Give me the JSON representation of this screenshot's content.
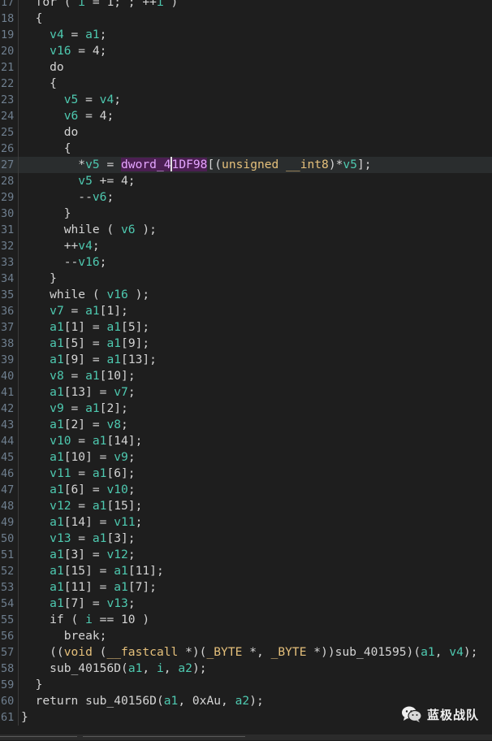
{
  "colors": {
    "background": "#1e1e1e",
    "identifier": "#4ec9b0",
    "type": "#e5c07b",
    "highlight_global": "#4b1f52",
    "line_number": "#6f7f8f"
  },
  "editor": {
    "highlighted_line": 27,
    "lines": [
      {
        "n": "17",
        "tokens": [
          [
            "t-kw",
            "  for ( "
          ],
          [
            "t-id",
            "i"
          ],
          [
            "t-op",
            " = 1; ; ++"
          ],
          [
            "t-id",
            "i"
          ],
          [
            "t-op",
            " )"
          ]
        ]
      },
      {
        "n": "18",
        "tokens": [
          [
            "t-op",
            "  {"
          ]
        ]
      },
      {
        "n": "19",
        "tokens": [
          [
            "t-op",
            "    "
          ],
          [
            "t-id",
            "v4"
          ],
          [
            "t-op",
            " = "
          ],
          [
            "t-id",
            "a1"
          ],
          [
            "t-op",
            ";"
          ]
        ]
      },
      {
        "n": "20",
        "tokens": [
          [
            "t-op",
            "    "
          ],
          [
            "t-id",
            "v16"
          ],
          [
            "t-op",
            " = 4;"
          ]
        ]
      },
      {
        "n": "21",
        "tokens": [
          [
            "t-kw",
            "    do"
          ]
        ]
      },
      {
        "n": "22",
        "tokens": [
          [
            "t-op",
            "    {"
          ]
        ]
      },
      {
        "n": "23",
        "tokens": [
          [
            "t-op",
            "      "
          ],
          [
            "t-id",
            "v5"
          ],
          [
            "t-op",
            " = "
          ],
          [
            "t-id",
            "v4"
          ],
          [
            "t-op",
            ";"
          ]
        ]
      },
      {
        "n": "24",
        "tokens": [
          [
            "t-op",
            "      "
          ],
          [
            "t-id",
            "v6"
          ],
          [
            "t-op",
            " = 4;"
          ]
        ]
      },
      {
        "n": "25",
        "tokens": [
          [
            "t-kw",
            "      do"
          ]
        ]
      },
      {
        "n": "26",
        "tokens": [
          [
            "t-op",
            "      {"
          ]
        ]
      },
      {
        "n": "27",
        "tokens": [
          [
            "t-op",
            "        *"
          ],
          [
            "t-id",
            "v5"
          ],
          [
            "t-op",
            " = "
          ],
          [
            "t-dw",
            "dword_4"
          ],
          [
            "cursor",
            ""
          ],
          [
            "t-dw",
            "1DF98"
          ],
          [
            "t-op",
            "[("
          ],
          [
            "t-ty",
            "unsigned __int8"
          ],
          [
            "t-op",
            ")*"
          ],
          [
            "t-id",
            "v5"
          ],
          [
            "t-op",
            "];"
          ]
        ]
      },
      {
        "n": "28",
        "tokens": [
          [
            "t-op",
            "        "
          ],
          [
            "t-id",
            "v5"
          ],
          [
            "t-op",
            " += 4;"
          ]
        ]
      },
      {
        "n": "29",
        "tokens": [
          [
            "t-op",
            "        --"
          ],
          [
            "t-id",
            "v6"
          ],
          [
            "t-op",
            ";"
          ]
        ]
      },
      {
        "n": "30",
        "tokens": [
          [
            "t-op",
            "      }"
          ]
        ]
      },
      {
        "n": "31",
        "tokens": [
          [
            "t-kw",
            "      while ( "
          ],
          [
            "t-id",
            "v6"
          ],
          [
            "t-op",
            " );"
          ]
        ]
      },
      {
        "n": "32",
        "tokens": [
          [
            "t-op",
            "      ++"
          ],
          [
            "t-id",
            "v4"
          ],
          [
            "t-op",
            ";"
          ]
        ]
      },
      {
        "n": "33",
        "tokens": [
          [
            "t-op",
            "      --"
          ],
          [
            "t-id",
            "v16"
          ],
          [
            "t-op",
            ";"
          ]
        ]
      },
      {
        "n": "34",
        "tokens": [
          [
            "t-op",
            "    }"
          ]
        ]
      },
      {
        "n": "35",
        "tokens": [
          [
            "t-kw",
            "    while ( "
          ],
          [
            "t-id",
            "v16"
          ],
          [
            "t-op",
            " );"
          ]
        ]
      },
      {
        "n": "36",
        "tokens": [
          [
            "t-op",
            "    "
          ],
          [
            "t-id",
            "v7"
          ],
          [
            "t-op",
            " = "
          ],
          [
            "t-id",
            "a1"
          ],
          [
            "t-op",
            "[1];"
          ]
        ]
      },
      {
        "n": "37",
        "tokens": [
          [
            "t-op",
            "    "
          ],
          [
            "t-id",
            "a1"
          ],
          [
            "t-op",
            "[1] = "
          ],
          [
            "t-id",
            "a1"
          ],
          [
            "t-op",
            "[5];"
          ]
        ]
      },
      {
        "n": "38",
        "tokens": [
          [
            "t-op",
            "    "
          ],
          [
            "t-id",
            "a1"
          ],
          [
            "t-op",
            "[5] = "
          ],
          [
            "t-id",
            "a1"
          ],
          [
            "t-op",
            "[9];"
          ]
        ]
      },
      {
        "n": "39",
        "tokens": [
          [
            "t-op",
            "    "
          ],
          [
            "t-id",
            "a1"
          ],
          [
            "t-op",
            "[9] = "
          ],
          [
            "t-id",
            "a1"
          ],
          [
            "t-op",
            "[13];"
          ]
        ]
      },
      {
        "n": "40",
        "tokens": [
          [
            "t-op",
            "    "
          ],
          [
            "t-id",
            "v8"
          ],
          [
            "t-op",
            " = "
          ],
          [
            "t-id",
            "a1"
          ],
          [
            "t-op",
            "[10];"
          ]
        ]
      },
      {
        "n": "41",
        "tokens": [
          [
            "t-op",
            "    "
          ],
          [
            "t-id",
            "a1"
          ],
          [
            "t-op",
            "[13] = "
          ],
          [
            "t-id",
            "v7"
          ],
          [
            "t-op",
            ";"
          ]
        ]
      },
      {
        "n": "42",
        "tokens": [
          [
            "t-op",
            "    "
          ],
          [
            "t-id",
            "v9"
          ],
          [
            "t-op",
            " = "
          ],
          [
            "t-id",
            "a1"
          ],
          [
            "t-op",
            "[2];"
          ]
        ]
      },
      {
        "n": "43",
        "tokens": [
          [
            "t-op",
            "    "
          ],
          [
            "t-id",
            "a1"
          ],
          [
            "t-op",
            "[2] = "
          ],
          [
            "t-id",
            "v8"
          ],
          [
            "t-op",
            ";"
          ]
        ]
      },
      {
        "n": "44",
        "tokens": [
          [
            "t-op",
            "    "
          ],
          [
            "t-id",
            "v10"
          ],
          [
            "t-op",
            " = "
          ],
          [
            "t-id",
            "a1"
          ],
          [
            "t-op",
            "[14];"
          ]
        ]
      },
      {
        "n": "45",
        "tokens": [
          [
            "t-op",
            "    "
          ],
          [
            "t-id",
            "a1"
          ],
          [
            "t-op",
            "[10] = "
          ],
          [
            "t-id",
            "v9"
          ],
          [
            "t-op",
            ";"
          ]
        ]
      },
      {
        "n": "46",
        "tokens": [
          [
            "t-op",
            "    "
          ],
          [
            "t-id",
            "v11"
          ],
          [
            "t-op",
            " = "
          ],
          [
            "t-id",
            "a1"
          ],
          [
            "t-op",
            "[6];"
          ]
        ]
      },
      {
        "n": "47",
        "tokens": [
          [
            "t-op",
            "    "
          ],
          [
            "t-id",
            "a1"
          ],
          [
            "t-op",
            "[6] = "
          ],
          [
            "t-id",
            "v10"
          ],
          [
            "t-op",
            ";"
          ]
        ]
      },
      {
        "n": "48",
        "tokens": [
          [
            "t-op",
            "    "
          ],
          [
            "t-id",
            "v12"
          ],
          [
            "t-op",
            " = "
          ],
          [
            "t-id",
            "a1"
          ],
          [
            "t-op",
            "[15];"
          ]
        ]
      },
      {
        "n": "49",
        "tokens": [
          [
            "t-op",
            "    "
          ],
          [
            "t-id",
            "a1"
          ],
          [
            "t-op",
            "[14] = "
          ],
          [
            "t-id",
            "v11"
          ],
          [
            "t-op",
            ";"
          ]
        ]
      },
      {
        "n": "50",
        "tokens": [
          [
            "t-op",
            "    "
          ],
          [
            "t-id",
            "v13"
          ],
          [
            "t-op",
            " = "
          ],
          [
            "t-id",
            "a1"
          ],
          [
            "t-op",
            "[3];"
          ]
        ]
      },
      {
        "n": "51",
        "tokens": [
          [
            "t-op",
            "    "
          ],
          [
            "t-id",
            "a1"
          ],
          [
            "t-op",
            "[3] = "
          ],
          [
            "t-id",
            "v12"
          ],
          [
            "t-op",
            ";"
          ]
        ]
      },
      {
        "n": "52",
        "tokens": [
          [
            "t-op",
            "    "
          ],
          [
            "t-id",
            "a1"
          ],
          [
            "t-op",
            "[15] = "
          ],
          [
            "t-id",
            "a1"
          ],
          [
            "t-op",
            "[11];"
          ]
        ]
      },
      {
        "n": "53",
        "tokens": [
          [
            "t-op",
            "    "
          ],
          [
            "t-id",
            "a1"
          ],
          [
            "t-op",
            "[11] = "
          ],
          [
            "t-id",
            "a1"
          ],
          [
            "t-op",
            "[7];"
          ]
        ]
      },
      {
        "n": "54",
        "tokens": [
          [
            "t-op",
            "    "
          ],
          [
            "t-id",
            "a1"
          ],
          [
            "t-op",
            "[7] = "
          ],
          [
            "t-id",
            "v13"
          ],
          [
            "t-op",
            ";"
          ]
        ]
      },
      {
        "n": "55",
        "tokens": [
          [
            "t-kw",
            "    if ( "
          ],
          [
            "t-id",
            "i"
          ],
          [
            "t-op",
            " == 10 )"
          ]
        ]
      },
      {
        "n": "56",
        "tokens": [
          [
            "t-kw",
            "      break;"
          ]
        ]
      },
      {
        "n": "57",
        "tokens": [
          [
            "t-op",
            "    (("
          ],
          [
            "t-ty",
            "void"
          ],
          [
            "t-op",
            " ("
          ],
          [
            "t-ty",
            "__fastcall"
          ],
          [
            "t-op",
            " *)("
          ],
          [
            "t-ty",
            "_BYTE"
          ],
          [
            "t-op",
            " *, "
          ],
          [
            "t-ty",
            "_BYTE"
          ],
          [
            "t-op",
            " *))"
          ],
          [
            "t-fn",
            "sub_401595"
          ],
          [
            "t-op",
            ")("
          ],
          [
            "t-id",
            "a1"
          ],
          [
            "t-op",
            ", "
          ],
          [
            "t-id",
            "v4"
          ],
          [
            "t-op",
            ");"
          ]
        ]
      },
      {
        "n": "58",
        "tokens": [
          [
            "t-op",
            "    "
          ],
          [
            "t-fn",
            "sub_40156D"
          ],
          [
            "t-op",
            "("
          ],
          [
            "t-id",
            "a1"
          ],
          [
            "t-op",
            ", "
          ],
          [
            "t-id",
            "i"
          ],
          [
            "t-op",
            ", "
          ],
          [
            "t-id",
            "a2"
          ],
          [
            "t-op",
            ");"
          ]
        ]
      },
      {
        "n": "59",
        "tokens": [
          [
            "t-op",
            "  }"
          ]
        ]
      },
      {
        "n": "60",
        "tokens": [
          [
            "t-kw",
            "  return "
          ],
          [
            "t-fn",
            "sub_40156D"
          ],
          [
            "t-op",
            "("
          ],
          [
            "t-id",
            "a1"
          ],
          [
            "t-op",
            ", 0xAu, "
          ],
          [
            "t-id",
            "a2"
          ],
          [
            "t-op",
            ");"
          ]
        ]
      },
      {
        "n": "61",
        "tokens": [
          [
            "t-op",
            "}"
          ]
        ]
      }
    ]
  },
  "watermark": {
    "icon": "wechat-icon",
    "text": "蓝极战队"
  }
}
